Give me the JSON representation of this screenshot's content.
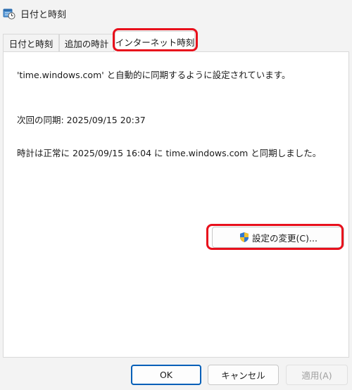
{
  "window": {
    "title": "日付と時刻",
    "icon": "calendar-clock-icon"
  },
  "tabs": [
    {
      "label": "日付と時刻",
      "active": false
    },
    {
      "label": "追加の時計",
      "active": false
    },
    {
      "label": "インターネット時刻",
      "active": true
    }
  ],
  "panel": {
    "sync_server_text": "'time.windows.com' と自動的に同期するように設定されています。",
    "next_sync_text": "次回の同期: 2025/09/15 20:37",
    "last_sync_text": "時計は正常に 2025/09/15 16:04 に time.windows.com と同期しました。",
    "change_settings_label": "設定の変更(C)..."
  },
  "footer": {
    "ok_label": "OK",
    "cancel_label": "キャンセル",
    "apply_label": "適用(A)",
    "apply_enabled": false
  },
  "colors": {
    "highlight": "#e8101c",
    "ok_border": "#005fb8",
    "window_bg": "#f3f3f3"
  }
}
